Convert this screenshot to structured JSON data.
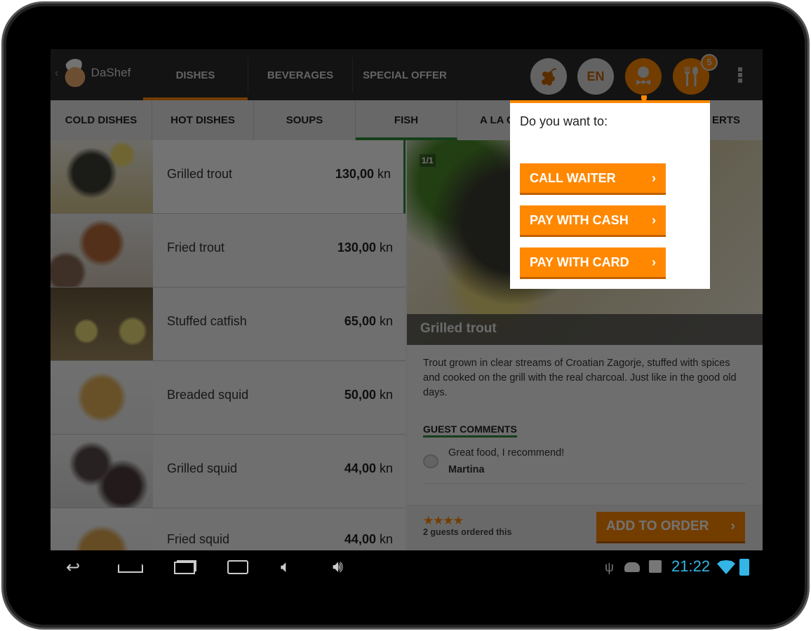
{
  "app": {
    "name": "DaShef"
  },
  "main_tabs": [
    {
      "label": "DISHES",
      "active": true
    },
    {
      "label": "BEVERAGES"
    },
    {
      "label": "SPECIAL OFFER"
    }
  ],
  "toolbar": {
    "language": "EN",
    "order_count": "5",
    "icons": [
      "grapes-icon",
      "language-button",
      "waiter-icon",
      "cutlery-icon",
      "overflow-menu-icon"
    ]
  },
  "sub_tabs": [
    {
      "label": "COLD DISHES"
    },
    {
      "label": "HOT DISHES"
    },
    {
      "label": "SOUPS"
    },
    {
      "label": "FISH",
      "active": true
    },
    {
      "label": "A LA C"
    },
    {
      "label": "ERTS"
    }
  ],
  "dishes": [
    {
      "name": "Grilled trout",
      "price": "130,00",
      "currency": "kn"
    },
    {
      "name": "Fried trout",
      "price": "130,00",
      "currency": "kn"
    },
    {
      "name": "Stuffed catfish",
      "price": "65,00",
      "currency": "kn"
    },
    {
      "name": "Breaded squid",
      "price": "50,00",
      "currency": "kn"
    },
    {
      "name": "Grilled squid",
      "price": "44,00",
      "currency": "kn"
    },
    {
      "name": "Fried squid",
      "price": "44,00",
      "currency": "kn"
    }
  ],
  "detail": {
    "counter": "1/1",
    "title": "Grilled trout",
    "description": "Trout grown in clear streams of Croatian Zagorje, stuffed with spices and cooked on the grill with the real charcoal. Just like in the good old days.",
    "comments_heading": "GUEST COMMENTS",
    "comments": [
      {
        "text": "Great food, I recommend!",
        "author": "Martina"
      }
    ],
    "rating": 4,
    "stars": "★★★★",
    "ordered_text": "2 guests ordered this",
    "add_button": "ADD TO ORDER"
  },
  "popup": {
    "title": "Do you want to:",
    "buttons": [
      "CALL WAITER",
      "PAY WITH CASH",
      "PAY WITH CARD"
    ]
  },
  "status": {
    "time": "21:22"
  },
  "colors": {
    "accent": "#ff8800",
    "active_subtab": "#2e8b3a",
    "time": "#33b5e5"
  }
}
